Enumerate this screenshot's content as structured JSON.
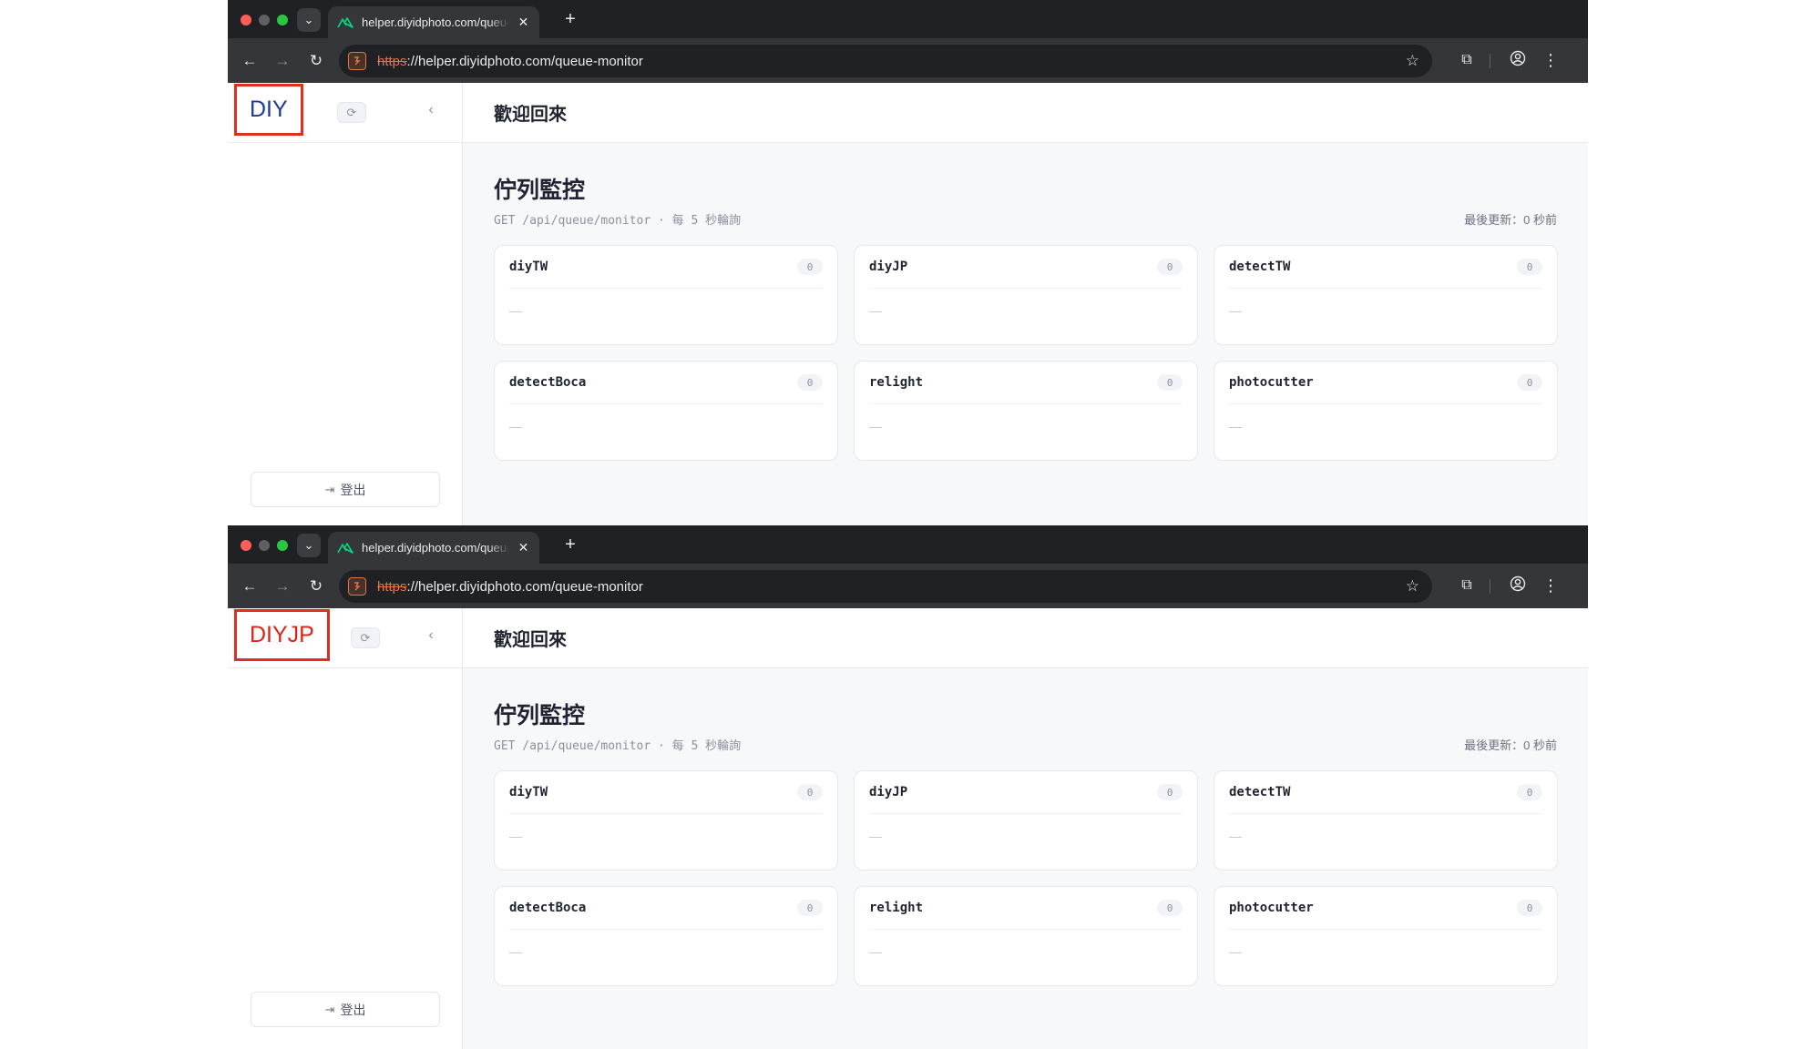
{
  "screens": [
    {
      "tab_title": "helper.diyidphoto.com/queue-monitor",
      "url_scheme": "https",
      "url_rest": "://helper.diyidphoto.com/queue-monitor",
      "brand": "DIY",
      "brand_color": "#1f3a93",
      "welcome": "歡迎回來",
      "page_title": "佇列監控",
      "subtitle": "GET /api/queue/monitor · 每 5 秒輪詢",
      "last_update": "最後更新：0 秒前",
      "logout_label": "登出",
      "queues": [
        {
          "name": "diyTW",
          "count": "0",
          "empty": "—"
        },
        {
          "name": "diyJP",
          "count": "0",
          "empty": "—"
        },
        {
          "name": "detectTW",
          "count": "0",
          "empty": "—"
        },
        {
          "name": "detectBoca",
          "count": "0",
          "empty": "—"
        },
        {
          "name": "relight",
          "count": "0",
          "empty": "—"
        },
        {
          "name": "photocutter",
          "count": "0",
          "empty": "—"
        }
      ]
    },
    {
      "tab_title": "helper.diyidphoto.com/queue-monitor",
      "url_scheme": "https",
      "url_rest": "://helper.diyidphoto.com/queue-monitor",
      "brand": "DIYJP",
      "brand_color": "#d6261a",
      "welcome": "歡迎回來",
      "page_title": "佇列監控",
      "subtitle": "GET /api/queue/monitor · 每 5 秒輪詢",
      "last_update": "最後更新：0 秒前",
      "logout_label": "登出",
      "queues": [
        {
          "name": "diyTW",
          "count": "0",
          "empty": "—"
        },
        {
          "name": "diyJP",
          "count": "0",
          "empty": "—"
        },
        {
          "name": "detectTW",
          "count": "0",
          "empty": "—"
        },
        {
          "name": "detectBoca",
          "count": "0",
          "empty": "—"
        },
        {
          "name": "relight",
          "count": "0",
          "empty": "—"
        },
        {
          "name": "photocutter",
          "count": "0",
          "empty": "—"
        }
      ]
    }
  ],
  "icons": {
    "tab_menu": "chevron-down-icon",
    "tab_favicon": "nuxt-logo-icon",
    "tab_close": "close-icon",
    "new_tab": "plus-icon",
    "back": "arrow-left-icon",
    "forward": "arrow-right-icon",
    "reload": "reload-icon",
    "site_info": "site-info-icon",
    "bookmark": "star-icon",
    "extensions": "puzzle-icon",
    "profile": "profile-icon",
    "menu": "kebab-menu-icon",
    "sync": "sync-icon",
    "collapse": "chevron-left-icon",
    "logout": "logout-icon"
  }
}
